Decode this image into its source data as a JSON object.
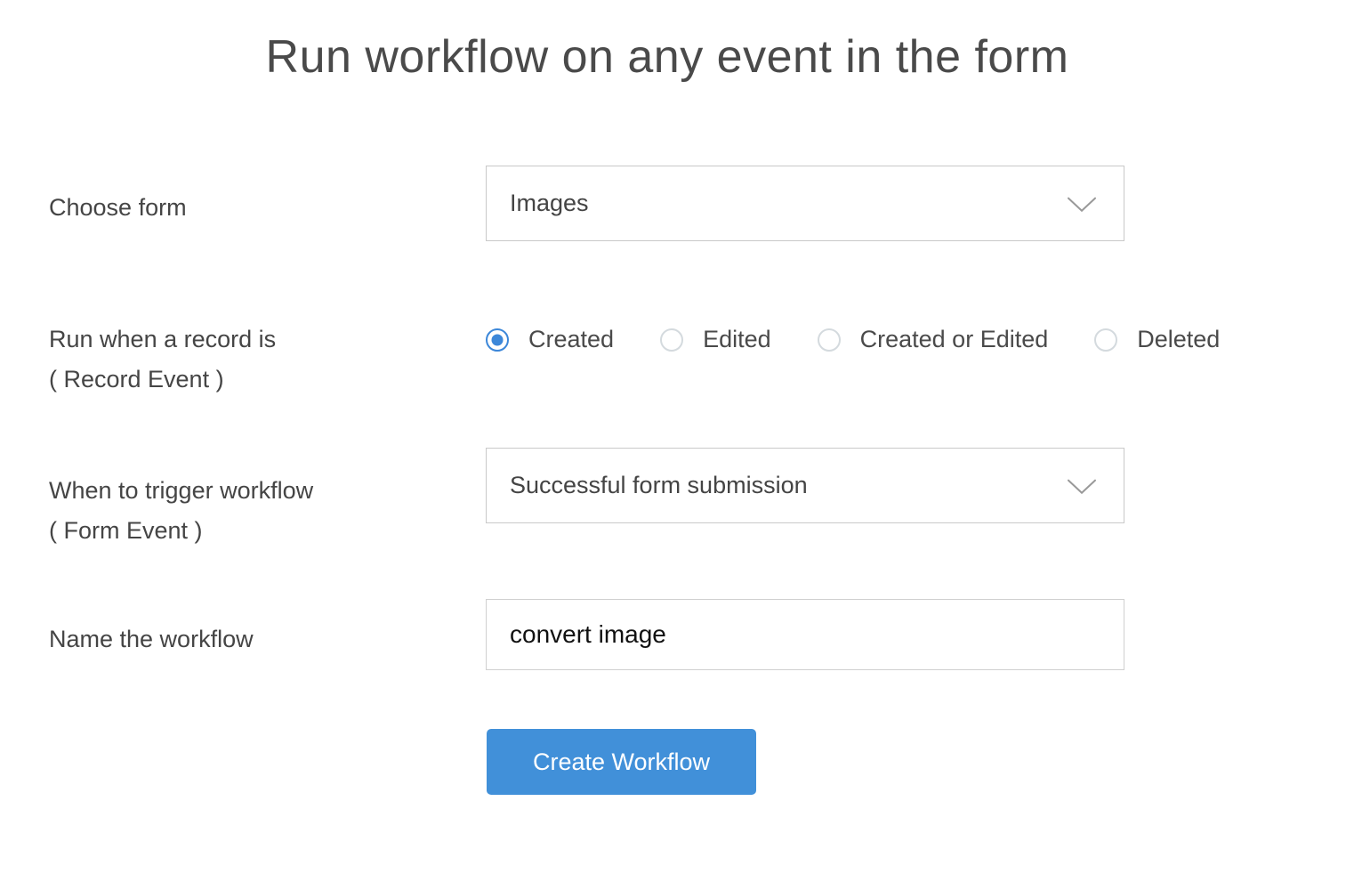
{
  "page": {
    "title": "Run workflow on any event in the form"
  },
  "form": {
    "choose_form": {
      "label": "Choose form",
      "value": "Images"
    },
    "record_event": {
      "label": "Run when a record is",
      "sublabel": "( Record Event )",
      "options": [
        {
          "label": "Created",
          "selected": true
        },
        {
          "label": "Edited",
          "selected": false
        },
        {
          "label": "Created or Edited",
          "selected": false
        },
        {
          "label": "Deleted",
          "selected": false
        }
      ]
    },
    "form_event": {
      "label": "When to trigger workflow",
      "sublabel": "( Form Event )",
      "value": "Successful form submission"
    },
    "workflow_name": {
      "label": "Name the workflow",
      "value": "convert image"
    },
    "submit": {
      "label": "Create Workflow"
    }
  },
  "icons": {
    "dropdown_chevron": "chevron-down-icon"
  },
  "colors": {
    "accent_blue": "#4190d9",
    "radio_selected_blue": "#3c87d9",
    "text_dark": "#454545",
    "title_gray": "#4a4a4a",
    "border_gray": "#c9c9c9",
    "radio_unselected_border": "#d4dade",
    "chevron_gray": "#999999",
    "background": "#ffffff"
  }
}
